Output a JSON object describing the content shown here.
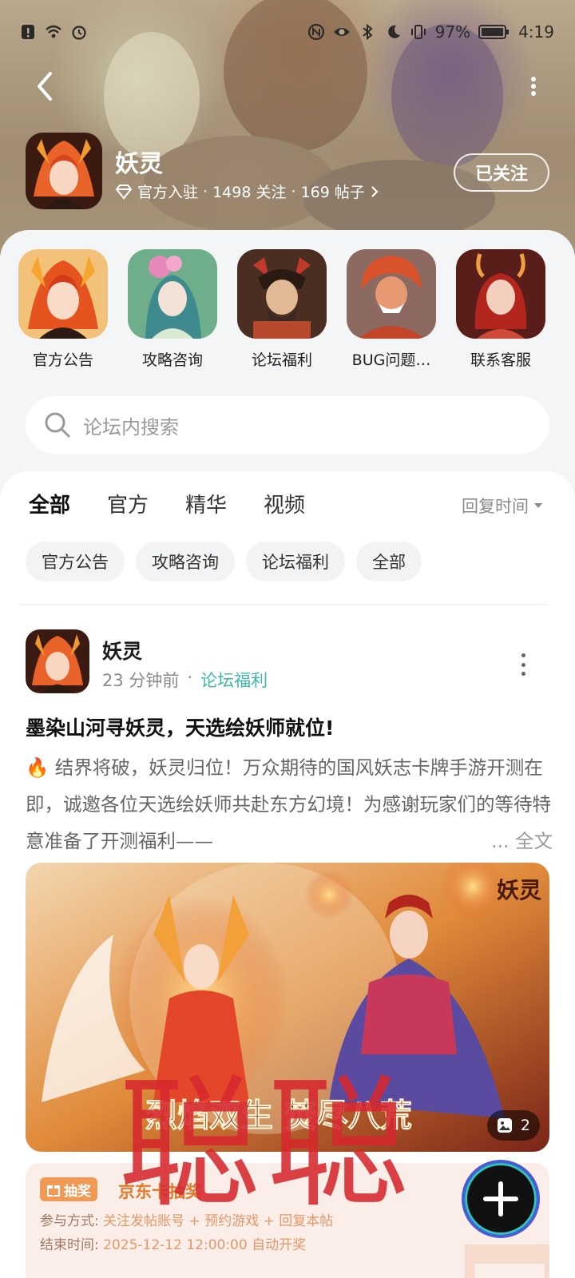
{
  "status_bar": {
    "battery": "97%",
    "time": "4:19"
  },
  "forum": {
    "name": "妖灵",
    "official_tag": "官方入驻",
    "followers": "1498 关注",
    "posts": "169 帖子",
    "follow_state": "已关注"
  },
  "shortcuts": [
    {
      "label": "官方公告"
    },
    {
      "label": "攻略咨询"
    },
    {
      "label": "论坛福利"
    },
    {
      "label": "BUG问题…"
    },
    {
      "label": "联系客服"
    }
  ],
  "search": {
    "placeholder": "论坛内搜索"
  },
  "tabs": [
    {
      "label": "全部",
      "active": true
    },
    {
      "label": "官方"
    },
    {
      "label": "精华"
    },
    {
      "label": "视频"
    }
  ],
  "sort": {
    "label": "回复时间"
  },
  "chips": [
    "官方公告",
    "攻略咨询",
    "论坛福利",
    "全部"
  ],
  "post": {
    "author": "妖灵",
    "time": "23 分钟前",
    "separator": "·",
    "board": "论坛福利",
    "title": "墨染山河寻妖灵，天选绘妖师就位!",
    "body": "🔥 结界将破，妖灵归位！万众期待的国风妖志卡牌手游开测在即，诚邀各位天选绘妖师共赴东方幻境！为感谢玩家们的等待特意准备了开测福利——",
    "ellipsis": "...",
    "full_text": "全文",
    "image_count": "2",
    "cover_logo": "妖灵",
    "cover_slogan": "烈焰双生 焚尽八荒"
  },
  "lottery": {
    "tag": "抽奖",
    "title": "京东卡抽奖",
    "join_label": "参与方式:",
    "join_value": "关注发帖账号 + 预约游戏 + 回复本帖",
    "end_label": "结束时间:",
    "end_value": "2025-12-12 12:00:00 自动开奖"
  },
  "watermark": "聪聪",
  "colors": {
    "accent": "#3cb8a9",
    "tab_underline": "#7fd8cf",
    "watermark": "#d6282e",
    "lottery_bg": "#fbeee8"
  }
}
